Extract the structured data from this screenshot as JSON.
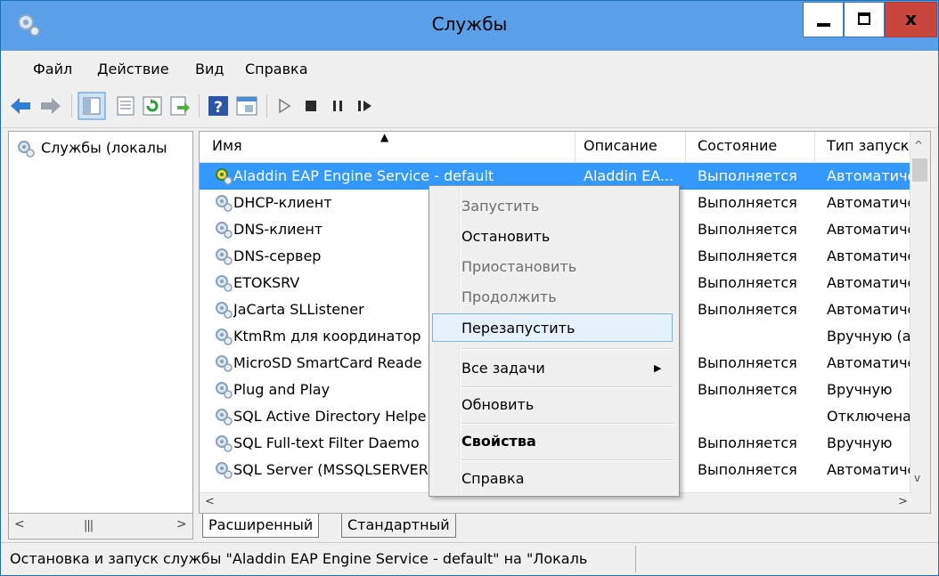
{
  "window": {
    "title": "Службы"
  },
  "menu": [
    "Файл",
    "Действие",
    "Вид",
    "Справка"
  ],
  "left_panel": {
    "tree_root": "Службы (локалы"
  },
  "columns": [
    "Имя",
    "Описание",
    "Состояние",
    "Тип запуска"
  ],
  "rows": [
    {
      "name": "Aladdin EAP Engine Service - default",
      "description": "Aladdin EA...",
      "state": "Выполняется",
      "startup": "Автоматиче"
    },
    {
      "name": "DHCP-клиент",
      "description": "",
      "state": "Выполняется",
      "startup": "Автоматиче"
    },
    {
      "name": "DNS-клиент",
      "description": "",
      "state": "Выполняется",
      "startup": "Автоматиче"
    },
    {
      "name": "DNS-сервер",
      "description": "",
      "state": "Выполняется",
      "startup": "Автоматиче"
    },
    {
      "name": "ETOKSRV",
      "description": "",
      "state": "Выполняется",
      "startup": "Автоматиче"
    },
    {
      "name": "JaCarta SLListener",
      "description": "",
      "state": "Выполняется",
      "startup": "Автоматиче"
    },
    {
      "name": "KtmRm для координатор",
      "description": "",
      "state": "",
      "startup": "Вручную (а"
    },
    {
      "name": "MicroSD SmartCard Reade",
      "description": "",
      "state": "Выполняется",
      "startup": "Автоматиче"
    },
    {
      "name": "Plug and Play",
      "description": "",
      "state": "Выполняется",
      "startup": "Вручную"
    },
    {
      "name": "SQL Active Directory Helpe",
      "description": "",
      "state": "",
      "startup": "Отключена"
    },
    {
      "name": "SQL Full-text Filter Daemo",
      "description": "",
      "state": "Выполняется",
      "startup": "Вручную"
    },
    {
      "name": "SQL Server (MSSQLSERVER",
      "description": "",
      "state": "Выполняется",
      "startup": "Автоматиче"
    }
  ],
  "context_menu": {
    "start": "Запустить",
    "stop": "Остановить",
    "pause": "Приостановить",
    "resume": "Продолжить",
    "restart": "Перезапустить",
    "all_tasks": "Все задачи",
    "refresh": "Обновить",
    "properties": "Свойства",
    "help": "Справка"
  },
  "tabs": [
    "Расширенный",
    "Стандартный"
  ],
  "status": "Остановка и запуск службы \"Aladdin EAP Engine Service - default\" на \"Локаль",
  "colors": {
    "titlebar": "#5aa0e8",
    "selection": "#3399ff",
    "close_button": "#c9463d",
    "menu_highlight": "#e5f1fb"
  },
  "icons": [
    "back-arrow-icon",
    "forward-arrow-icon",
    "show-hide-tree-icon",
    "properties-icon",
    "refresh-icon",
    "export-list-icon",
    "help-icon",
    "console-view-icon",
    "start-service-icon",
    "stop-service-icon",
    "pause-service-icon",
    "restart-service-icon",
    "service-gear-icon"
  ]
}
